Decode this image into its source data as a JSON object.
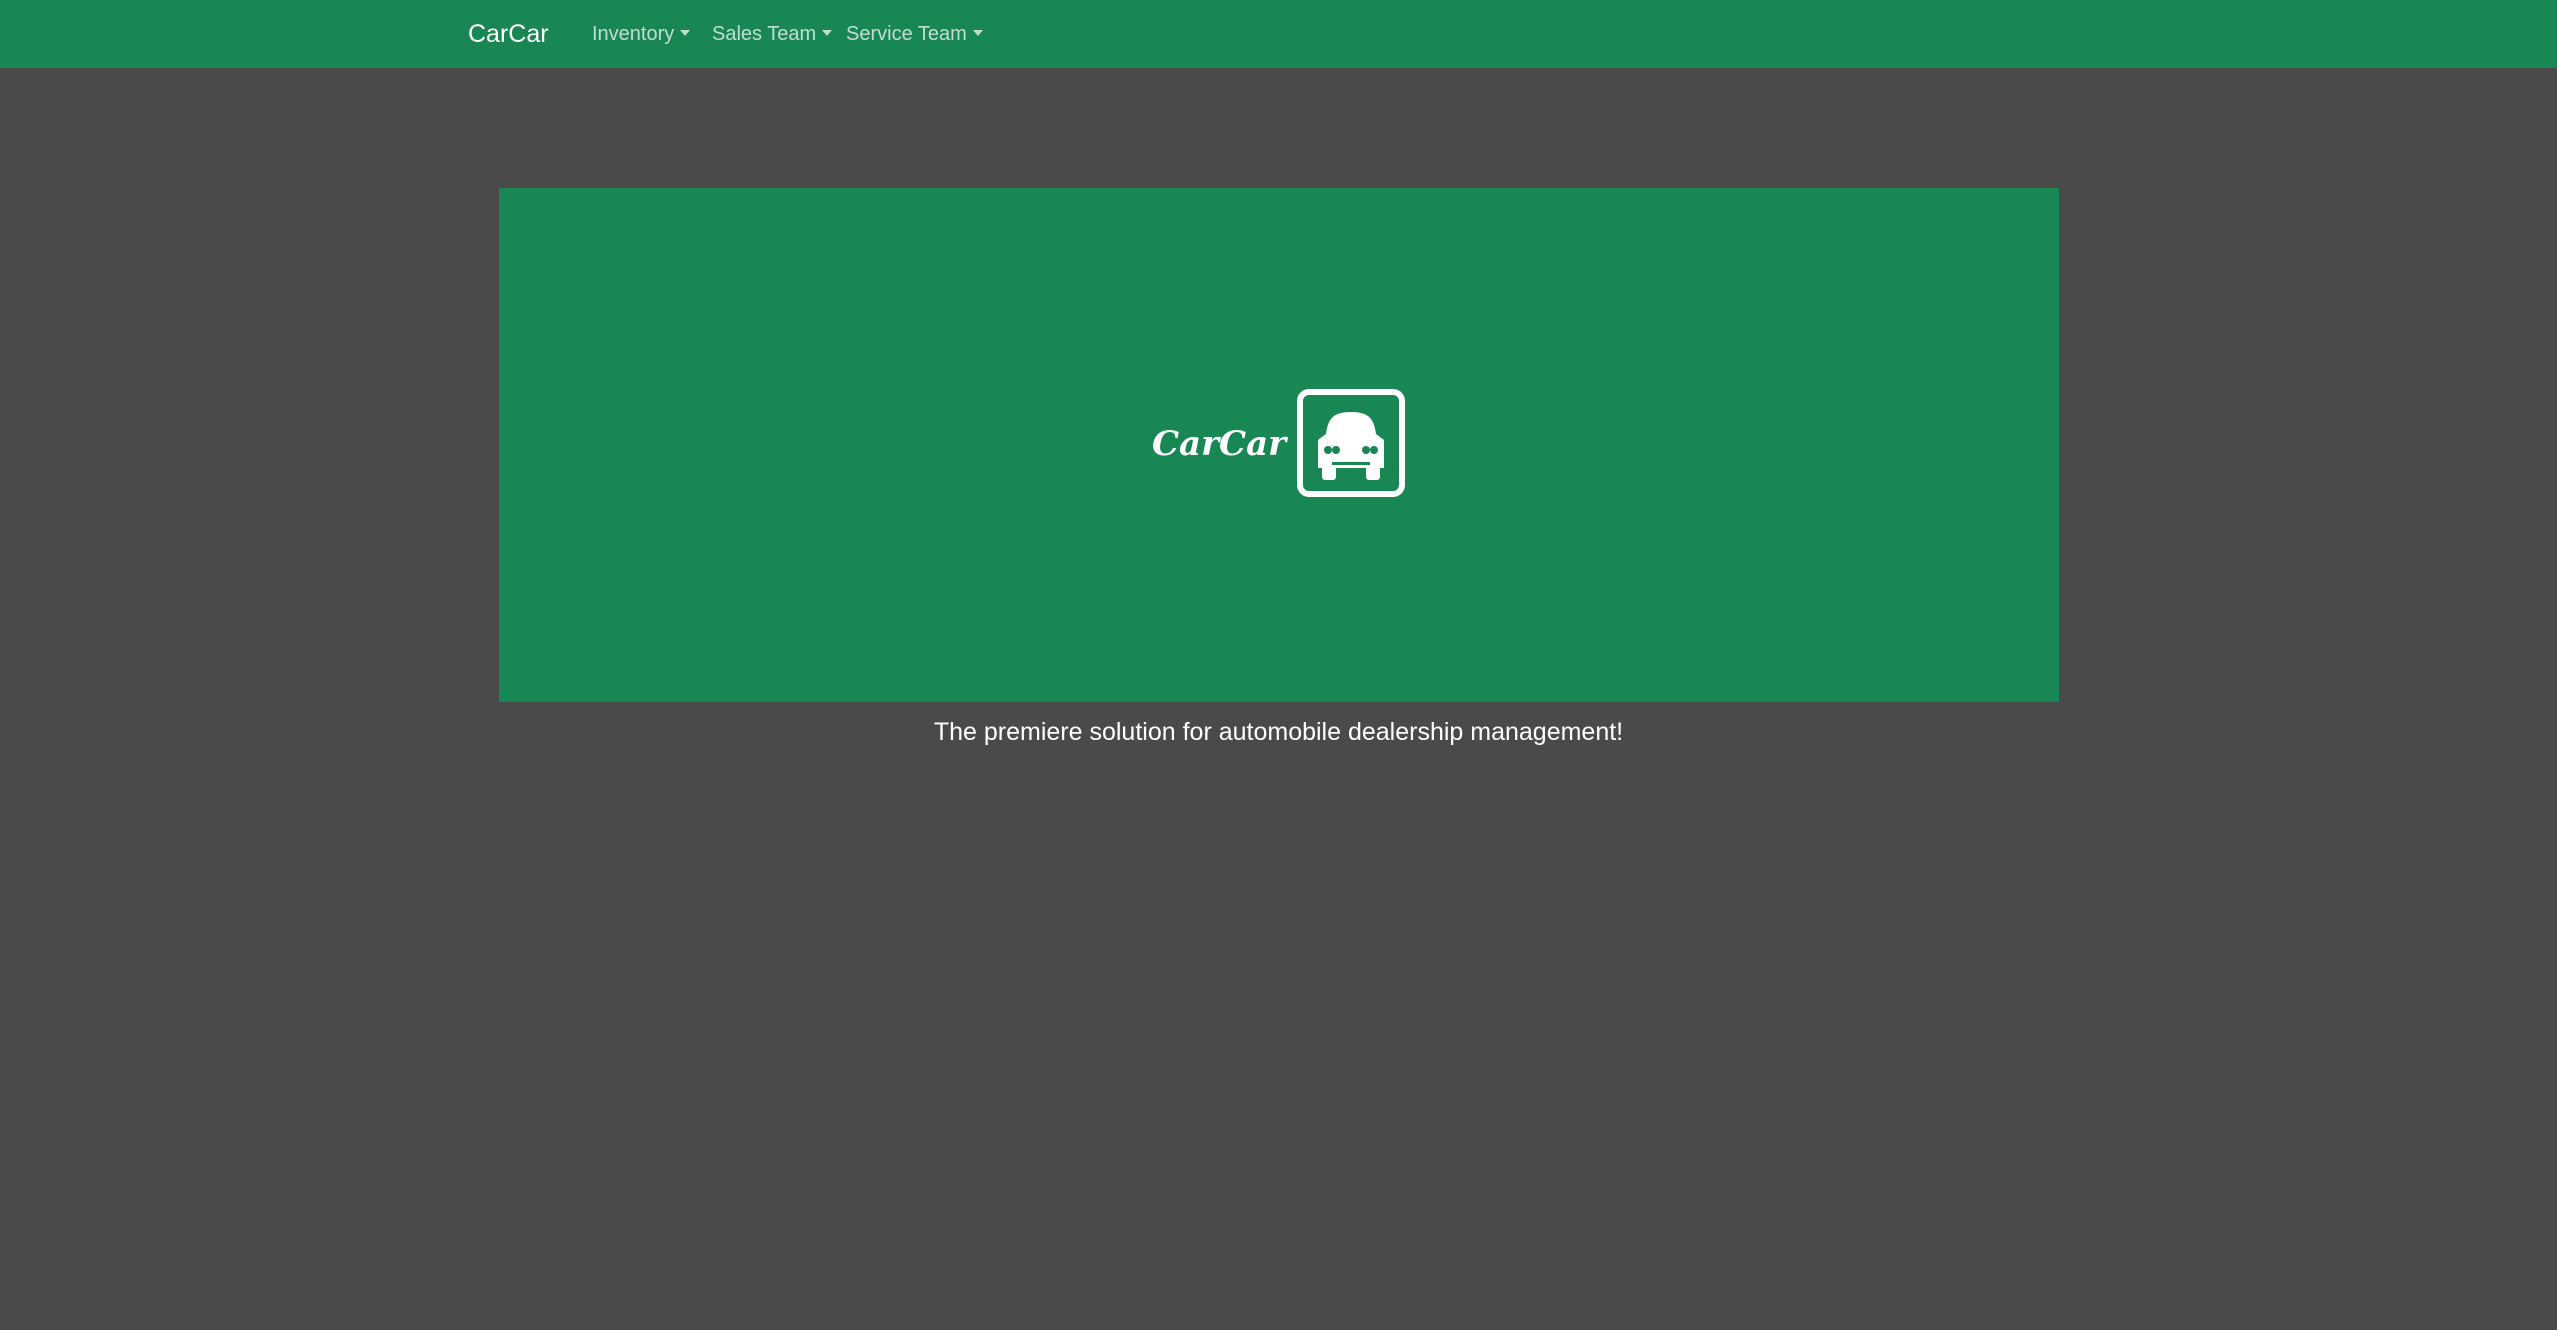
{
  "navbar": {
    "brand": "CarCar",
    "items": [
      {
        "label": "Inventory"
      },
      {
        "label": "Sales Team"
      },
      {
        "label": "Service Team"
      }
    ]
  },
  "hero": {
    "logo_text": "CarCar",
    "logo_icon": "car-front-icon",
    "tagline": "The premiere solution for automobile dealership management!"
  },
  "colors": {
    "brand_green": "#198754",
    "page_background": "#4a4a4a",
    "text_light": "#ffffff"
  }
}
